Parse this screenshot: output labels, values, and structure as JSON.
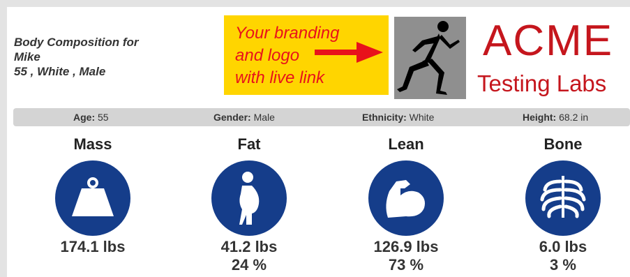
{
  "header": {
    "title_line1": "Body Composition for",
    "name": "Mike",
    "subtitle": "55 , White , Male"
  },
  "promo": {
    "line1": "Your branding",
    "line2": "and logo",
    "line3": "with live link",
    "bg_color": "#ffd500",
    "text_color": "#e8121b"
  },
  "logo": {
    "name": "ACME",
    "subtitle": "Testing Labs",
    "color": "#c5161d"
  },
  "info_bar": {
    "age_label": "Age:",
    "age_value": "55",
    "gender_label": "Gender:",
    "gender_value": "Male",
    "ethnicity_label": "Ethnicity:",
    "ethnicity_value": "White",
    "height_label": "Height:",
    "height_value": "68.2 in"
  },
  "metrics": [
    {
      "title": "Mass",
      "icon": "weight-icon",
      "value": "174.1 lbs",
      "percent": ""
    },
    {
      "title": "Fat",
      "icon": "body-fat-icon",
      "value": "41.2 lbs",
      "percent": "24 %"
    },
    {
      "title": "Lean",
      "icon": "muscle-arm-icon",
      "value": "126.9 lbs",
      "percent": "73 %"
    },
    {
      "title": "Bone",
      "icon": "ribcage-icon",
      "value": "6.0 lbs",
      "percent": "3 %"
    }
  ],
  "colors": {
    "icon_circle": "#153d8a",
    "info_bar": "#d4d4d4"
  }
}
